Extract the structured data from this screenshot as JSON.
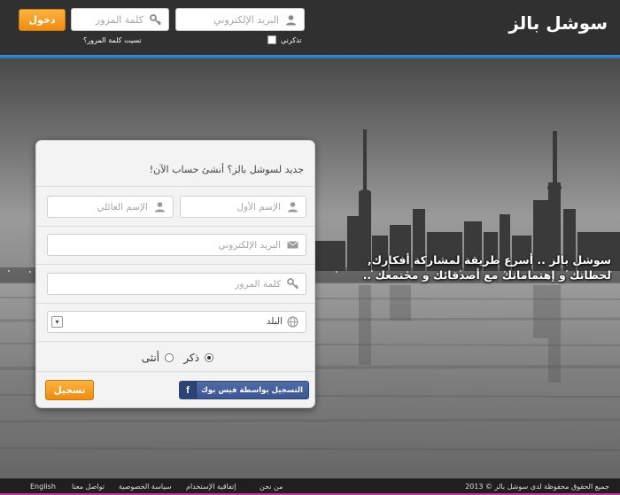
{
  "header": {
    "logo": "سوشل بالز",
    "email_placeholder": "البريد الإلكتروني",
    "password_placeholder": "كلمة المرور",
    "login_label": "دخول",
    "remember_label": "تذكرني",
    "forgot_label": "نسيت كلمة المرور؟"
  },
  "hero": {
    "tagline_line1": "سوشل بالز .. أسرع طريقة لمشاركة أفكارك,",
    "tagline_line2": "لحظاتك و إهتماماتك مع أصدقائك و مختمعك .."
  },
  "signup": {
    "title": "جديد لسوشل بالز؟ أنشئ حساب الآن!",
    "first_name_placeholder": "الإسم الأول",
    "last_name_placeholder": "الإسم العائلي",
    "email_placeholder": "البريد الإلكتروني",
    "password_placeholder": "كلمة المرور",
    "country_selected": "البلد",
    "gender_male": "ذكر",
    "gender_female": "أنثى",
    "facebook_label": "التسجيل بواسطة فيس بوك",
    "facebook_icon_letter": "f",
    "register_label": "تسجيل"
  },
  "footer": {
    "copyright": "جميع الحقوق محفوظة لدى سوشل بالز © 2013",
    "links": [
      "من نحن",
      "إتفاقية الإستخدام",
      "سياسة الخصوصية",
      "تواصل معنا",
      "English"
    ]
  },
  "colors": {
    "header_bg": "#303030",
    "accent_blue": "#3c8ed3",
    "button_orange": "#f0931b",
    "facebook_blue": "#3b5693",
    "footer_accent": "#c0399a"
  }
}
